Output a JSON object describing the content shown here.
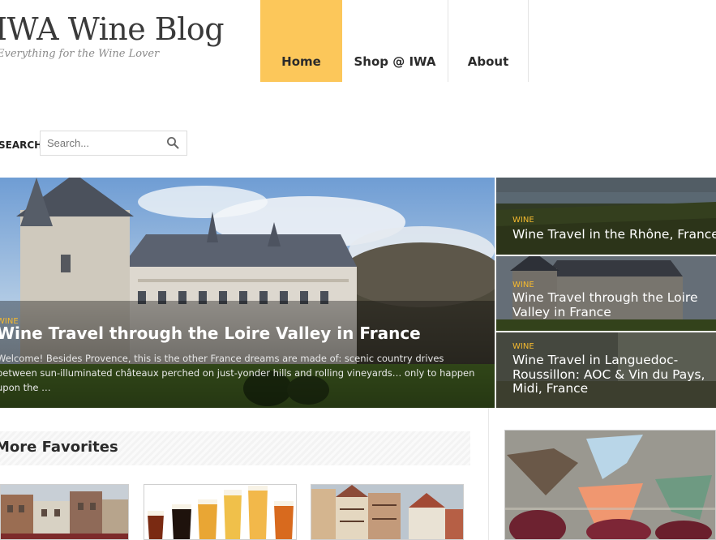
{
  "site": {
    "title": "IWA Wine Blog",
    "tagline": "Everything for the Wine Lover"
  },
  "nav": {
    "items": [
      {
        "label": "Home",
        "active": true
      },
      {
        "label": "Shop @ IWA",
        "active": false
      },
      {
        "label": "About",
        "active": false
      }
    ]
  },
  "search": {
    "label": "SEARCH",
    "placeholder": "Search..."
  },
  "slider": {
    "main": {
      "category": "WINE",
      "title": "Wine Travel through the Loire Valley in France",
      "excerpt": "Welcome! Besides Provence, this is the other France dreams are made of: scenic country drives between sun-illuminated châteaux perched on just-yonder hills and rolling vineyards… only to happen upon the …"
    },
    "side": [
      {
        "category": "WINE",
        "title_lines": [
          "Wine Travel in the Rhône, France"
        ]
      },
      {
        "category": "WINE",
        "title_lines": [
          "Wine Travel through the Loire",
          "Valley in France"
        ]
      },
      {
        "category": "WINE",
        "title_lines": [
          "Wine Travel in Languedoc-",
          "Roussillon: AOC & Vin du Pays,",
          "Midi, France"
        ]
      }
    ]
  },
  "favorites": {
    "title": "More Favorites"
  },
  "colors": {
    "accent": "#fcc75a",
    "category": "#f4b92f"
  },
  "icons": {
    "search": "search-icon"
  }
}
